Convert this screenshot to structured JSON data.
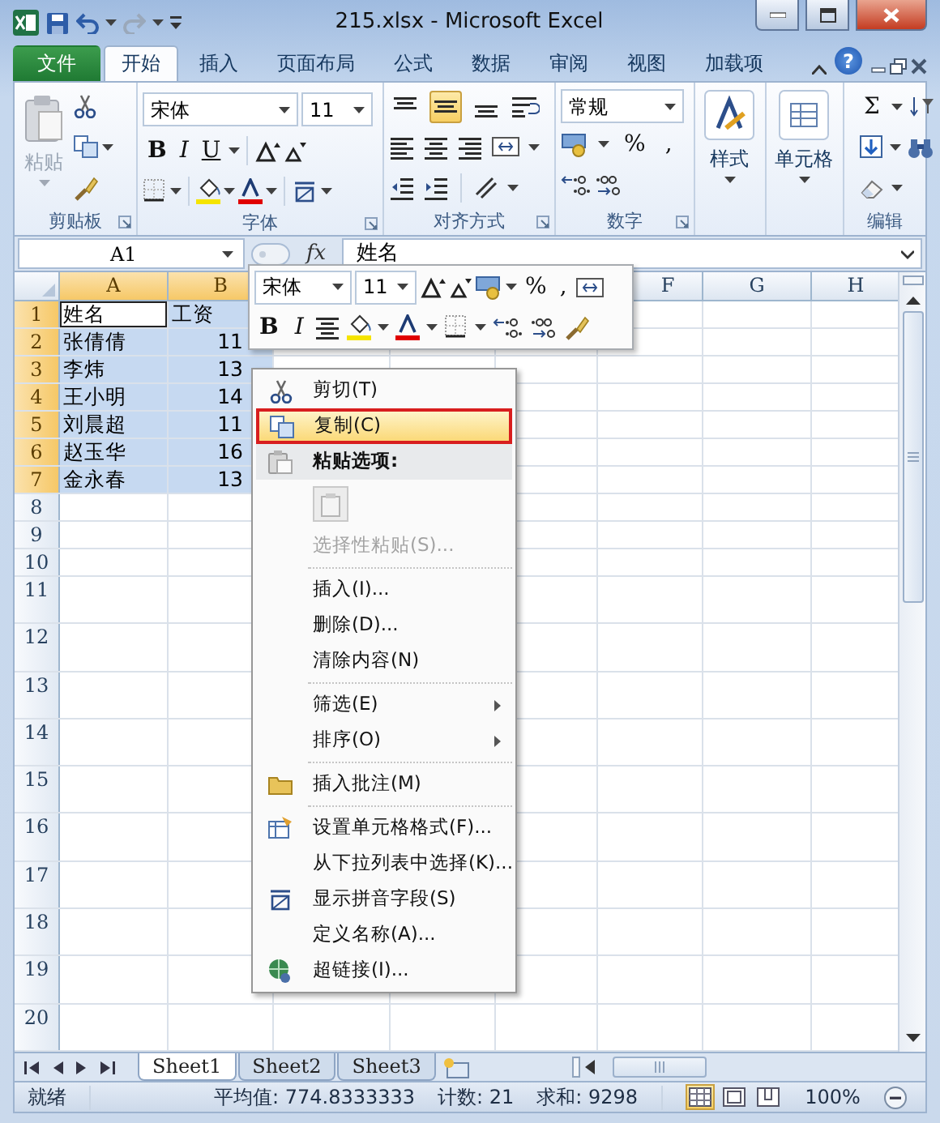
{
  "window": {
    "title": "215.xlsx - Microsoft Excel"
  },
  "tabs": [
    {
      "label": "文件",
      "kind": "file",
      "selected": false
    },
    {
      "label": "开始",
      "kind": "tab",
      "selected": true
    },
    {
      "label": "插入",
      "kind": "tab",
      "selected": false
    },
    {
      "label": "页面布局",
      "kind": "tab",
      "selected": false
    },
    {
      "label": "公式",
      "kind": "tab",
      "selected": false
    },
    {
      "label": "数据",
      "kind": "tab",
      "selected": false
    },
    {
      "label": "审阅",
      "kind": "tab",
      "selected": false
    },
    {
      "label": "视图",
      "kind": "tab",
      "selected": false
    },
    {
      "label": "加载项",
      "kind": "tab",
      "selected": false
    }
  ],
  "help": "?",
  "ribbon": {
    "clipboard": {
      "label": "剪贴板",
      "paste": "粘贴",
      "disabled": true
    },
    "font": {
      "label": "字体",
      "font": "宋体",
      "size": "11",
      "styles": [
        {
          "label": "B",
          "kind": "bold"
        },
        {
          "label": "I",
          "kind": "italic"
        },
        {
          "label": "U",
          "kind": "underline"
        }
      ]
    },
    "alignment": {
      "label": "对齐方式",
      "vertical": [
        {
          "selected": false
        },
        {
          "selected": true
        },
        {
          "selected": false
        }
      ]
    },
    "number": {
      "label": "数字",
      "format": "常规",
      "symbols": [
        "%",
        ","
      ]
    },
    "styles": {
      "button": "样式"
    },
    "cells": {
      "button": "单元格"
    },
    "editing": {
      "label": "编辑",
      "sum": "Σ"
    }
  },
  "formula_bar": {
    "name_box": "A1",
    "fx": "fx",
    "formula": "姓名"
  },
  "sheet": {
    "columns": [
      {
        "label": "A",
        "selected": true
      },
      {
        "label": "B",
        "selected": true
      },
      {
        "label": "F",
        "selected": false
      },
      {
        "label": "G",
        "selected": false
      },
      {
        "label": "H",
        "selected": false
      }
    ],
    "rows": [
      {
        "label": "1",
        "selected": true,
        "cells": [
          {
            "text": "姓名",
            "kind": "text",
            "active": true
          },
          {
            "text": "工资",
            "kind": "text",
            "active": false
          }
        ]
      },
      {
        "label": "2",
        "selected": true,
        "cells": [
          {
            "text": "张倩倩",
            "kind": "text",
            "active": false
          },
          {
            "text": "11",
            "kind": "number",
            "active": false
          }
        ]
      },
      {
        "label": "3",
        "selected": true,
        "cells": [
          {
            "text": "李炜",
            "kind": "text",
            "active": false
          },
          {
            "text": "13",
            "kind": "number",
            "active": false
          }
        ]
      },
      {
        "label": "4",
        "selected": true,
        "cells": [
          {
            "text": "王小明",
            "kind": "text",
            "active": false
          },
          {
            "text": "14",
            "kind": "number",
            "active": false
          }
        ]
      },
      {
        "label": "5",
        "selected": true,
        "cells": [
          {
            "text": "刘晨超",
            "kind": "text",
            "active": false
          },
          {
            "text": "11",
            "kind": "number",
            "active": false
          }
        ]
      },
      {
        "label": "6",
        "selected": true,
        "cells": [
          {
            "text": "赵玉华",
            "kind": "text",
            "active": false
          },
          {
            "text": "16",
            "kind": "number",
            "active": false
          }
        ]
      },
      {
        "label": "7",
        "selected": true,
        "cells": [
          {
            "text": "金永春",
            "kind": "text",
            "active": false
          },
          {
            "text": "13",
            "kind": "number",
            "active": false
          }
        ]
      },
      {
        "label": "8",
        "selected": false
      },
      {
        "label": "9",
        "selected": false
      },
      {
        "label": "10",
        "selected": false
      },
      {
        "label": "11",
        "selected": false
      },
      {
        "label": "12",
        "selected": false
      },
      {
        "label": "13",
        "selected": false
      },
      {
        "label": "14",
        "selected": false
      },
      {
        "label": "15",
        "selected": false
      },
      {
        "label": "16",
        "selected": false
      },
      {
        "label": "17",
        "selected": false
      },
      {
        "label": "18",
        "selected": false
      },
      {
        "label": "19",
        "selected": false
      },
      {
        "label": "20",
        "selected": false
      }
    ]
  },
  "mini_toolbar": {
    "font": "宋体",
    "size": "11",
    "symbols": [
      "%",
      ","
    ],
    "styles": [
      {
        "label": "B",
        "kind": "bold"
      },
      {
        "label": "I",
        "kind": "italic"
      }
    ]
  },
  "context_menu": {
    "items": [
      {
        "label": "剪切(T)",
        "kind": "item",
        "selected": false,
        "disabled": false,
        "submenu": false
      },
      {
        "label": "复制(C)",
        "kind": "item",
        "selected": true,
        "disabled": false,
        "submenu": false
      },
      {
        "label": "粘贴选项:",
        "kind": "header"
      },
      {
        "kind": "paste_options"
      },
      {
        "label": "选择性粘贴(S)...",
        "kind": "item",
        "selected": false,
        "disabled": true,
        "submenu": false
      },
      {
        "kind": "separator"
      },
      {
        "label": "插入(I)...",
        "kind": "item",
        "selected": false,
        "disabled": false,
        "submenu": false
      },
      {
        "label": "删除(D)...",
        "kind": "item",
        "selected": false,
        "disabled": false,
        "submenu": false
      },
      {
        "label": "清除内容(N)",
        "kind": "item",
        "selected": false,
        "disabled": false,
        "submenu": false
      },
      {
        "kind": "separator"
      },
      {
        "label": "筛选(E)",
        "kind": "item",
        "selected": false,
        "disabled": false,
        "submenu": true
      },
      {
        "label": "排序(O)",
        "kind": "item",
        "selected": false,
        "disabled": false,
        "submenu": true
      },
      {
        "kind": "separator"
      },
      {
        "label": "插入批注(M)",
        "kind": "item",
        "selected": false,
        "disabled": false,
        "submenu": false
      },
      {
        "kind": "separator"
      },
      {
        "label": "设置单元格格式(F)...",
        "kind": "item",
        "selected": false,
        "disabled": false,
        "submenu": false
      },
      {
        "label": "从下拉列表中选择(K)...",
        "kind": "item",
        "selected": false,
        "disabled": false,
        "submenu": false
      },
      {
        "label": "显示拼音字段(S)",
        "kind": "item",
        "selected": false,
        "disabled": false,
        "submenu": false
      },
      {
        "label": "定义名称(A)...",
        "kind": "item",
        "selected": false,
        "disabled": false,
        "submenu": false
      },
      {
        "label": "超链接(I)...",
        "kind": "item",
        "selected": false,
        "disabled": false,
        "submenu": false
      }
    ]
  },
  "sheet_tabs": [
    {
      "label": "Sheet1",
      "selected": true
    },
    {
      "label": "Sheet2",
      "selected": false
    },
    {
      "label": "Sheet3",
      "selected": false
    }
  ],
  "status_bar": {
    "ready": "就绪",
    "average": "平均值: 774.8333333",
    "count": "计数: 21",
    "sum": "求和: 9298",
    "views": [
      {
        "selected": true
      },
      {
        "selected": false
      },
      {
        "selected": false
      }
    ],
    "zoom": "100%"
  }
}
